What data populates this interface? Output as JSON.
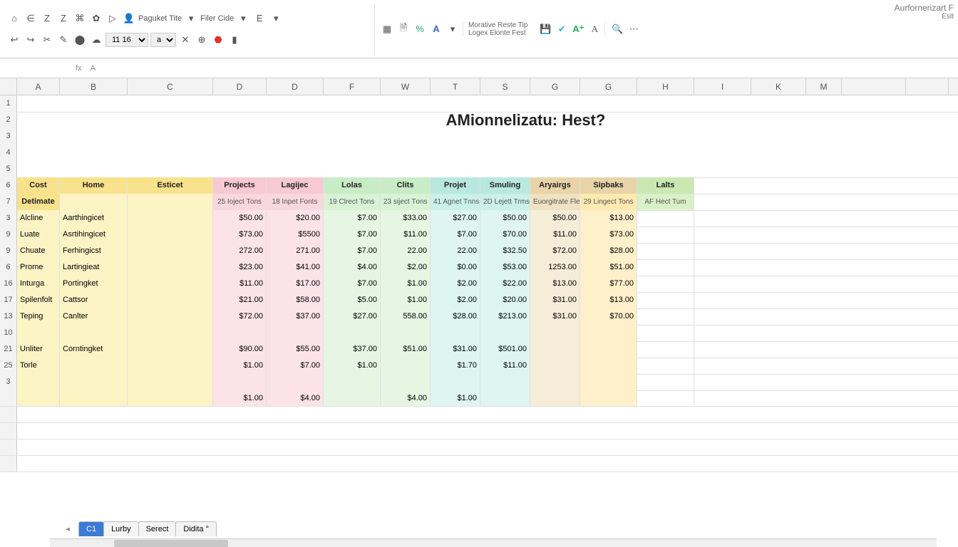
{
  "ribbon": {
    "row1_title_a": "Morative Reste Tip",
    "row1_title_b": "Logex Elonte Fest",
    "percent_icon": "%",
    "font_dropdown": "11 16",
    "size_dropdown": "a",
    "paguket": "Paguket Tite",
    "filer": "Filer Cide",
    "e": "E"
  },
  "sidebar_note_a": "Aurfornerizart F",
  "sidebar_note_b": "Eslt",
  "namebox": {
    "cell": "",
    "fx": "fx",
    "formula": "A"
  },
  "col_letters": [
    "",
    "A",
    "B",
    "C",
    "D",
    "D",
    "F",
    "W",
    "T",
    "S",
    "G",
    "G",
    "H",
    "I",
    "K",
    "M",
    "",
    "",
    "",
    ""
  ],
  "row_nums": [
    "1",
    "2",
    "3",
    "4",
    "5",
    "6",
    "7",
    "3",
    "9",
    "9",
    "6",
    "16",
    "17",
    "13",
    "10",
    "21",
    "25",
    "3",
    "",
    "",
    ""
  ],
  "page_title": "AMionnelizatu: Hest?",
  "headers": {
    "cost": "Cost",
    "home": "Home",
    "esticet": "Esticet",
    "projects": "Projects",
    "lagijec": "Lagijec",
    "lolas": "Lolas",
    "clits": "Clits",
    "projet": "Projet",
    "smuling": "Smuling",
    "aryairgs": "Aryairgs",
    "sipbaks": "Sipbaks",
    "lalts": "Lalts"
  },
  "subheaders": {
    "detimate": "Detimate",
    "d": "25 Ioject Тоns",
    "f": "18 Inpet Fonts",
    "w": "19 Clrect Tons",
    "t": "23 siject Tоns",
    "s": "41 Agnet Tnns",
    "g": "2D Lejett Trms",
    "gh": "Euorgitrate Flent",
    "h": "29 Lingect Tons",
    "i": "AF Hect Tum"
  },
  "data": [
    {
      "a": "Alcline",
      "b": "Aarthingicet",
      "d": "$50.00",
      "f": "$20.00",
      "w": "$7.00",
      "t": "$33.00",
      "s": "$27.00",
      "g": "$50.00",
      "gh": "$50.00",
      "h": "$13.00",
      "i": ""
    },
    {
      "a": "Luate",
      "b": "Asrtihingicet",
      "d": "$73.00",
      "f": "$5500",
      "w": "$7.00",
      "t": "$11.00",
      "s": "$7.00",
      "g": "$70.00",
      "gh": "$11.00",
      "h": "$73.00",
      "i": ""
    },
    {
      "a": "Chuate",
      "b": "Ferhingicst",
      "d": "272.00",
      "f": "271.00",
      "w": "$7.00",
      "t": "22.00",
      "s": "22.00",
      "g": "$32.50",
      "gh": "$72.00",
      "h": "$28.00",
      "i": ""
    },
    {
      "a": "Prome",
      "b": "Lartingieat",
      "d": "$23.00",
      "f": "$41.00",
      "w": "$4.00",
      "t": "$2.00",
      "s": "$0.00",
      "g": "$53.00",
      "gh": "1253.00",
      "h": "$51.00",
      "i": ""
    },
    {
      "a": "Inturga",
      "b": "Portingket",
      "d": "$11.00",
      "f": "$17.00",
      "w": "$7.00",
      "t": "$1.00",
      "s": "$2.00",
      "g": "$22.00",
      "gh": "$13.00",
      "h": "$77.00",
      "i": ""
    },
    {
      "a": "Spilenfolt",
      "b": "Cattsor",
      "d": "$21.00",
      "f": "$58.00",
      "w": "$5.00",
      "t": "$1.00",
      "s": "$2.00",
      "g": "$20.00",
      "gh": "$31.00",
      "h": "$13.00",
      "i": ""
    },
    {
      "a": "Teping",
      "b": "Canlter",
      "d": "$72.00",
      "f": "$37.00",
      "w": "$27.00",
      "t": "558.00",
      "s": "$28.00",
      "g": "$213.00",
      "gh": "$31.00",
      "h": "$70.00",
      "i": ""
    },
    {
      "a": "",
      "b": "",
      "d": "",
      "f": "",
      "w": "",
      "t": "",
      "s": "",
      "g": "",
      "gh": "",
      "h": "",
      "i": ""
    },
    {
      "a": "Unliter",
      "b": "Corntingket",
      "d": "$90.00",
      "f": "$55.00",
      "w": "$37.00",
      "t": "$51.00",
      "s": "$31.00",
      "g": "$501.00",
      "gh": "",
      "h": "",
      "i": ""
    },
    {
      "a": "Torle",
      "b": "",
      "d": "$1.00",
      "f": "$7.00",
      "w": "$1.00",
      "t": "",
      "s": "$1.70",
      "g": "$11.00",
      "gh": "",
      "h": "",
      "i": ""
    },
    {
      "a": "",
      "b": "",
      "d": "",
      "f": "",
      "w": "",
      "t": "",
      "s": "",
      "g": "",
      "gh": "",
      "h": "",
      "i": ""
    },
    {
      "a": "",
      "b": "",
      "d": "$1.00",
      "f": "$4.00",
      "w": "",
      "t": "$4.00",
      "s": "$1.00",
      "g": "",
      "gh": "",
      "h": "",
      "i": ""
    }
  ],
  "tabs": {
    "nav": "◂",
    "t1": "C1",
    "t2": "Lurby",
    "t3": "Serect",
    "t4": "Didita °"
  },
  "colors": {
    "yellow": "#f9e28c",
    "pink": "#f7c9d2",
    "green": "#c8ecc6",
    "teal": "#b9e8e0",
    "tan": "#e8d4a8"
  }
}
